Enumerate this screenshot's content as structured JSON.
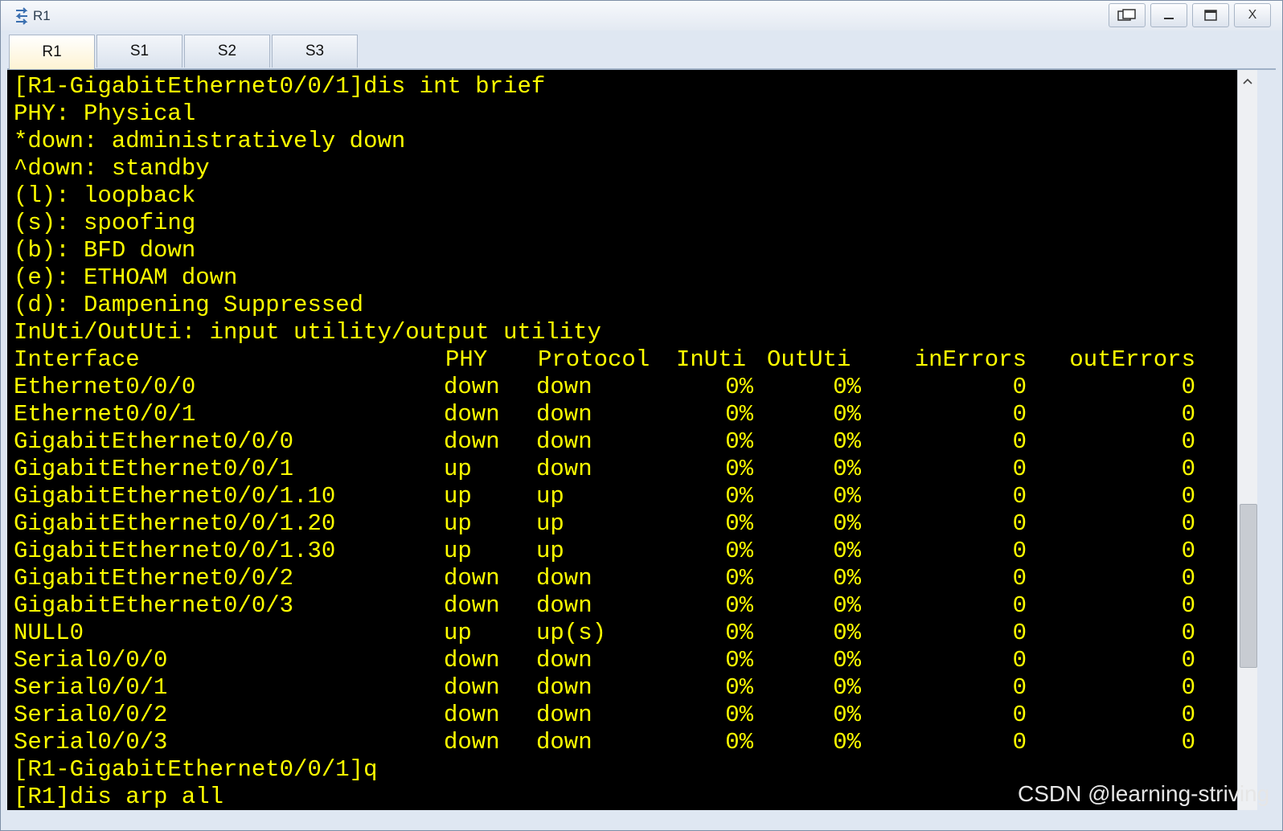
{
  "window": {
    "title": "R1"
  },
  "tabs": [
    {
      "label": "R1",
      "active": true
    },
    {
      "label": "S1",
      "active": false
    },
    {
      "label": "S2",
      "active": false
    },
    {
      "label": "S3",
      "active": false
    }
  ],
  "terminal": {
    "text_color": "#ffff00",
    "background": "#000000",
    "header_lines": [
      "[R1-GigabitEthernet0/0/1]dis int brief",
      "PHY: Physical",
      "*down: administratively down",
      "^down: standby",
      "(l): loopback",
      "(s): spoofing",
      "(b): BFD down",
      "(e): ETHOAM down",
      "(d): Dampening Suppressed",
      "InUti/OutUti: input utility/output utility"
    ],
    "columns": [
      "Interface",
      "PHY",
      "Protocol",
      "InUti",
      "OutUti",
      "inErrors",
      "outErrors"
    ],
    "rows": [
      [
        "Ethernet0/0/0",
        "down",
        "down",
        "0%",
        "0%",
        "0",
        "0"
      ],
      [
        "Ethernet0/0/1",
        "down",
        "down",
        "0%",
        "0%",
        "0",
        "0"
      ],
      [
        "GigabitEthernet0/0/0",
        "down",
        "down",
        "0%",
        "0%",
        "0",
        "0"
      ],
      [
        "GigabitEthernet0/0/1",
        "up",
        "down",
        "0%",
        "0%",
        "0",
        "0"
      ],
      [
        "GigabitEthernet0/0/1.10",
        "up",
        "up",
        "0%",
        "0%",
        "0",
        "0"
      ],
      [
        "GigabitEthernet0/0/1.20",
        "up",
        "up",
        "0%",
        "0%",
        "0",
        "0"
      ],
      [
        "GigabitEthernet0/0/1.30",
        "up",
        "up",
        "0%",
        "0%",
        "0",
        "0"
      ],
      [
        "GigabitEthernet0/0/2",
        "down",
        "down",
        "0%",
        "0%",
        "0",
        "0"
      ],
      [
        "GigabitEthernet0/0/3",
        "down",
        "down",
        "0%",
        "0%",
        "0",
        "0"
      ],
      [
        "NULL0",
        "up",
        "up(s)",
        "0%",
        "0%",
        "0",
        "0"
      ],
      [
        "Serial0/0/0",
        "down",
        "down",
        "0%",
        "0%",
        "0",
        "0"
      ],
      [
        "Serial0/0/1",
        "down",
        "down",
        "0%",
        "0%",
        "0",
        "0"
      ],
      [
        "Serial0/0/2",
        "down",
        "down",
        "0%",
        "0%",
        "0",
        "0"
      ],
      [
        "Serial0/0/3",
        "down",
        "down",
        "0%",
        "0%",
        "0",
        "0"
      ]
    ],
    "footer_lines": [
      "[R1-GigabitEthernet0/0/1]q",
      "[R1]dis arp all"
    ]
  },
  "watermark": "CSDN @learning-striving",
  "icons": {
    "app": "router-icon",
    "restore": "restore-window-icon",
    "minimize": "minimize-icon",
    "maximize": "maximize-icon",
    "close": "close-icon",
    "scroll_up": "scroll-up-arrow-icon"
  },
  "labels": {
    "close": "X"
  }
}
